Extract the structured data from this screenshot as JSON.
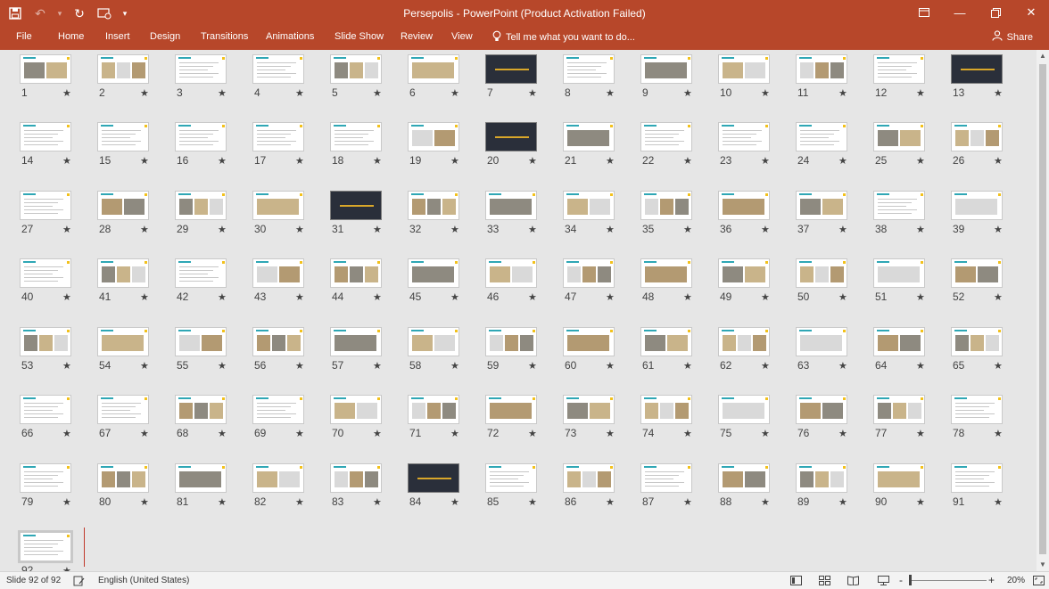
{
  "window": {
    "title": "Persepolis - PowerPoint (Product Activation Failed)",
    "qat_icons": [
      "save-icon",
      "undo-icon",
      "redo-icon",
      "present-from-start-icon",
      "customize-qat-icon"
    ],
    "controls": [
      "ribbon-display-icon",
      "minimize-icon",
      "maximize-icon",
      "close-icon"
    ]
  },
  "ribbon": {
    "tabs": [
      "File",
      "Home",
      "Insert",
      "Design",
      "Transitions",
      "Animations",
      "Slide Show",
      "Review",
      "View"
    ],
    "tell_me": "Tell me what you want to do...",
    "share": "Share"
  },
  "slides": {
    "count": 92,
    "star_glyph": "★",
    "dark_slides": [
      7,
      13,
      20,
      31,
      84
    ],
    "picture_slides": [
      1,
      2,
      5,
      6,
      9,
      10,
      11,
      19,
      21,
      25,
      26,
      28,
      29,
      30,
      32,
      33,
      34,
      35,
      36,
      37,
      39,
      41,
      43,
      44,
      45,
      46,
      47,
      48,
      49,
      50,
      51,
      52,
      53,
      54,
      55,
      56,
      57,
      58,
      59,
      60,
      61,
      62,
      63,
      64,
      65,
      68,
      70,
      71,
      72,
      73,
      74,
      75,
      76,
      77,
      80,
      81,
      82,
      83,
      86,
      88,
      89,
      90
    ],
    "selected": 92
  },
  "status": {
    "slide_info": "Slide 92 of 92",
    "language": "English (United States)",
    "zoom": "20%",
    "zoom_minus": "-",
    "zoom_plus": "+"
  },
  "colors": {
    "ribbon": "#b7472a",
    "slide_header": "#2fa7b5",
    "slide_accent": "#f2c11c",
    "dark_slide": "#2a2f3a"
  }
}
